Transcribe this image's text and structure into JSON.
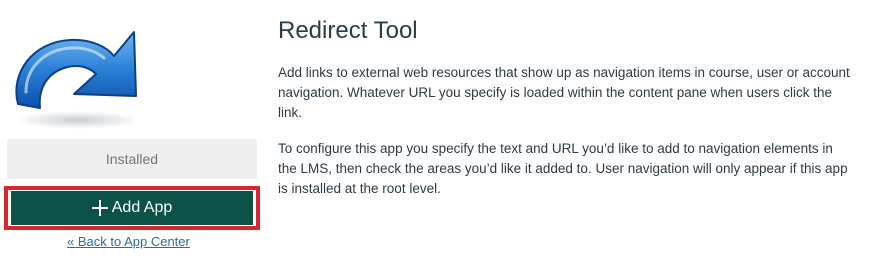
{
  "app": {
    "title": "Redirect Tool",
    "description_1": "Add links to external web resources that show up as navigation items in course, user or account navigation. Whatever URL you specify is loaded within the content pane when users click the link.",
    "description_2": "To configure this app you specify the text and URL you’d like to add to navigation elements in the LMS, then check the areas you’d like it added to. User navigation will only appear if this app is installed at the root level.",
    "logo_icon": "curved-arrow-redirect-icon"
  },
  "sidebar": {
    "installed_label": "Installed",
    "add_app_label": "Add App",
    "add_icon": "plus-icon",
    "back_link_label": "« Back to App Center"
  },
  "colors": {
    "button_bg": "#0c5248",
    "highlight_border": "#d8252e",
    "link": "#2d6f99",
    "badge_bg": "#eeeeee"
  }
}
